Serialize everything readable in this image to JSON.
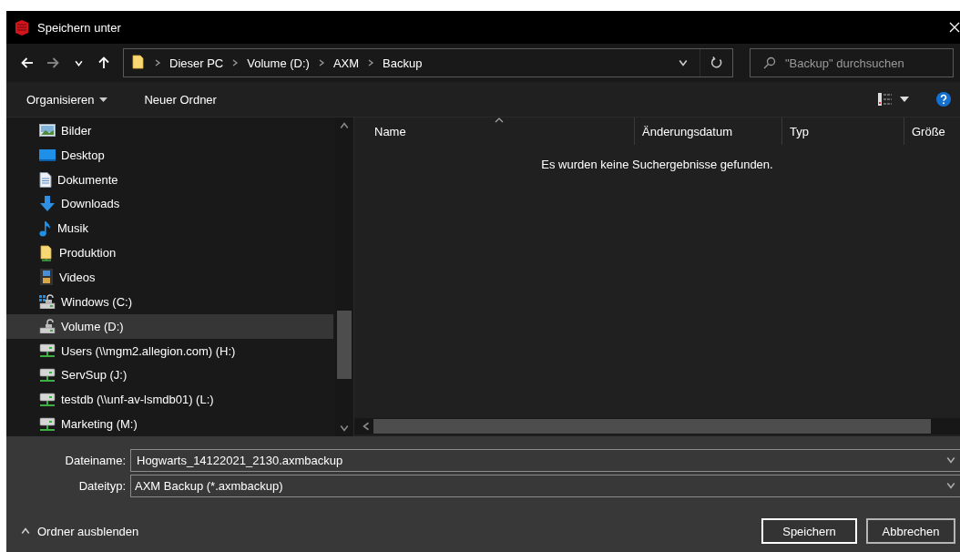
{
  "window": {
    "title": "Speichern unter"
  },
  "nav_buttons": [
    {
      "kind": "back",
      "disabled": false
    },
    {
      "kind": "forward",
      "disabled": true
    },
    {
      "kind": "recent",
      "disabled": false
    },
    {
      "kind": "up",
      "disabled": false
    }
  ],
  "address": {
    "breadcrumbs": [
      "Dieser PC",
      "Volume (D:)",
      "AXM",
      "Backup"
    ]
  },
  "search": {
    "placeholder": "\"Backup\" durchsuchen"
  },
  "toolbar": {
    "items": [
      {
        "label": "Organisieren",
        "has_menu": true
      },
      {
        "label": "Neuer Ordner",
        "has_menu": false
      }
    ]
  },
  "sidebar": {
    "items": [
      {
        "label": "Bilder",
        "kind": "pictures",
        "selected": false
      },
      {
        "label": "Desktop",
        "kind": "desktop",
        "selected": false
      },
      {
        "label": "Dokumente",
        "kind": "documents",
        "selected": false
      },
      {
        "label": "Downloads",
        "kind": "downloads",
        "selected": false
      },
      {
        "label": "Musik",
        "kind": "music",
        "selected": false
      },
      {
        "label": "Produktion",
        "kind": "sharedfolder",
        "selected": false
      },
      {
        "label": "Videos",
        "kind": "videos",
        "selected": false
      },
      {
        "label": "Windows (C:)",
        "kind": "systemdrive",
        "selected": false
      },
      {
        "label": "Volume (D:)",
        "kind": "drive",
        "selected": true
      },
      {
        "label": "Users (\\\\mgm2.allegion.com) (H:)",
        "kind": "networkdrive",
        "selected": false
      },
      {
        "label": "ServSup (J:)",
        "kind": "networkdrive",
        "selected": false
      },
      {
        "label": "testdb (\\\\unf-av-lsmdb01) (L:)",
        "kind": "networkdrive",
        "selected": false
      },
      {
        "label": "Marketing (M:)",
        "kind": "networkdrive",
        "selected": false
      }
    ]
  },
  "file_list": {
    "columns": [
      {
        "label": "Name",
        "sorted": true
      },
      {
        "label": "Änderungsdatum",
        "sorted": false
      },
      {
        "label": "Typ",
        "sorted": false
      },
      {
        "label": "Größe",
        "sorted": false
      }
    ],
    "empty_message": "Es wurden keine Suchergebnisse gefunden."
  },
  "form": {
    "fields": [
      {
        "label": "Dateiname:",
        "value": "Hogwarts_14122021_2130.axmbackup"
      },
      {
        "label": "Dateityp:",
        "value": "AXM Backup (*.axmbackup)"
      }
    ]
  },
  "hide_folders": {
    "label": "Ordner ausblenden"
  },
  "buttons": [
    {
      "label": "Speichern",
      "default": true
    },
    {
      "label": "Abbrechen",
      "default": false
    }
  ]
}
